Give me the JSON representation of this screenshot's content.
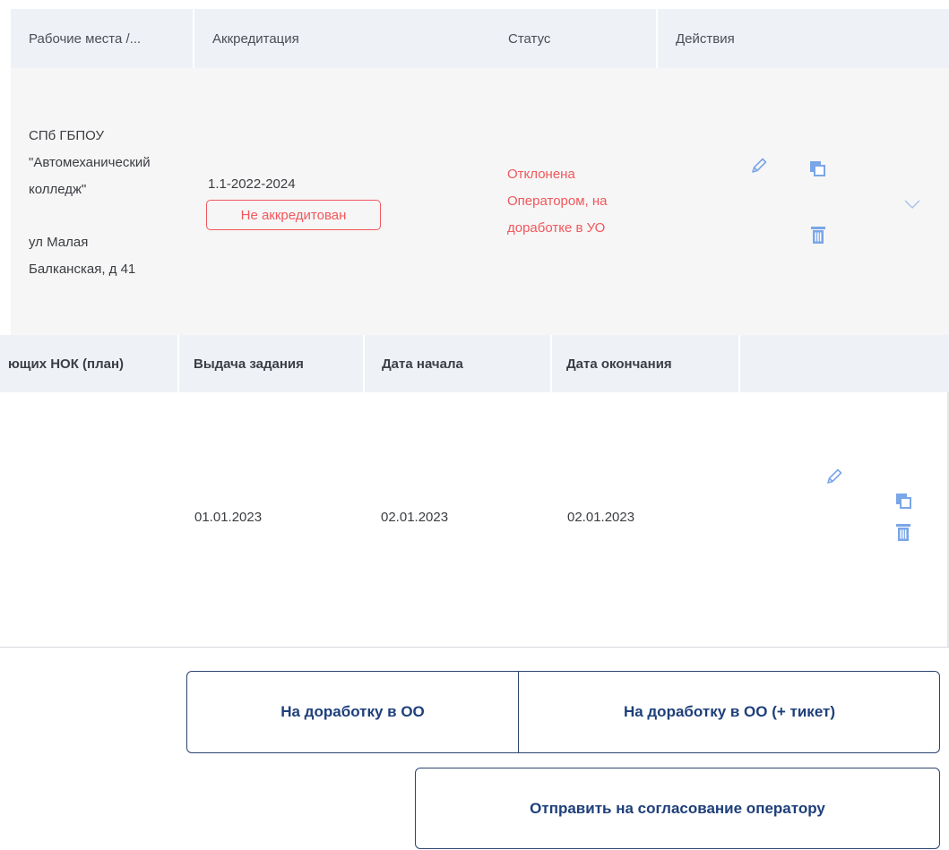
{
  "top_table": {
    "headers": {
      "workplaces": "Рабочие места /...",
      "accreditation": "Аккредитация",
      "status": "Статус",
      "actions": "Действия"
    },
    "row": {
      "org_line1": "СПб ГБПОУ",
      "org_line2": "\"Автомеханический",
      "org_line3": "колледж\"",
      "addr_line1": "ул Малая",
      "addr_line2": "Балканская, д 41",
      "accreditation_code": "1.1-2022-2024",
      "accreditation_badge": "Не аккредитован",
      "status_line1": "Отклонена",
      "status_line2": "Оператором, на",
      "status_line3": "доработке в УО"
    }
  },
  "bottom_table": {
    "headers": {
      "nok_plan": "ющих НОК (план)",
      "task_issue": "Выдача задания",
      "start_date": "Дата начала",
      "end_date": "Дата окончания"
    },
    "row": {
      "task_issue": "01.01.2023",
      "start_date": "02.01.2023",
      "end_date": "02.01.2023"
    }
  },
  "buttons": {
    "rework_oo": "На доработку в ОО",
    "rework_oo_ticket": "На доработку в ОО (+ тикет)",
    "send_to_operator": "Отправить на согласование оператору"
  },
  "colors": {
    "accent": "#1e3f7a",
    "icon": "#7aa6e8",
    "status_red": "#f2575c",
    "header_bg": "#eef1f6"
  },
  "icons": [
    "pencil-icon",
    "copy-icon",
    "trash-icon",
    "chevron-down-icon"
  ]
}
